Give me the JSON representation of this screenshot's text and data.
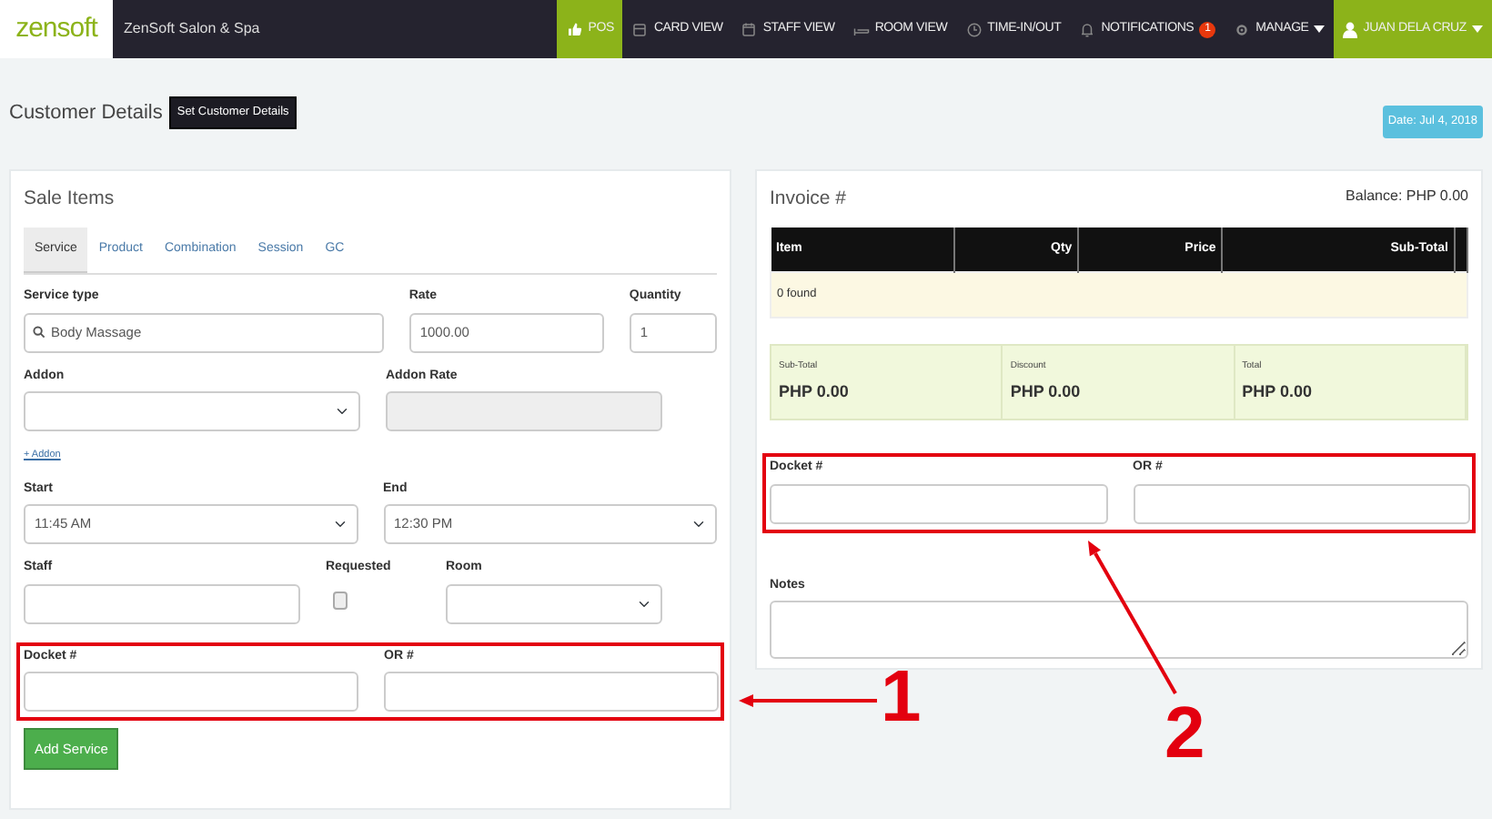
{
  "navbar": {
    "logo": "**zen**soft",
    "brand": "ZenSoft Salon & Spa",
    "items": [
      {
        "label": "POS",
        "selected": true
      },
      {
        "label": "CARD VIEW",
        "selected": false
      },
      {
        "label": "STAFF VIEW",
        "selected": false
      },
      {
        "label": "ROOM VIEW",
        "selected": false
      },
      {
        "label": "TIME-IN/OUT",
        "selected": false
      },
      {
        "label": "NOTIFICATIONS",
        "selected": false,
        "badge": "1"
      },
      {
        "label": "MANAGE",
        "selected": false,
        "dropdown": true
      }
    ],
    "user": {
      "label": "JUAN DELA CRUZ",
      "dropdown": true
    }
  },
  "header": {
    "title": "Customer Details",
    "button": "Set Customer Details",
    "date": "Date: Jul 4, 2018"
  },
  "sale_items": {
    "title": "Sale Items",
    "tabs": [
      {
        "label": "Service",
        "selected": true
      },
      {
        "label": "Product",
        "selected": false
      },
      {
        "label": "Combination",
        "selected": false
      },
      {
        "label": "Session",
        "selected": false
      },
      {
        "label": "GC",
        "selected": false
      }
    ],
    "service_type": {
      "label": "Service type",
      "value": "Body Massage"
    },
    "rate": {
      "label": "Rate",
      "value": "1000.00"
    },
    "quantity": {
      "label": "Quantity",
      "value": "1"
    },
    "addon": {
      "label": "Addon"
    },
    "addon_rate": {
      "label": "Addon Rate",
      "disabled": true
    },
    "add_addon": "+ Addon",
    "start": {
      "label": "Start",
      "value": "11:45 AM"
    },
    "end": {
      "label": "End",
      "value": "12:30 PM"
    },
    "staff": {
      "label": "Staff"
    },
    "requested": {
      "label": "Requested",
      "checked": false
    },
    "room": {
      "label": "Room"
    },
    "references_highlighted": true,
    "docket": {
      "label": "Docket #"
    },
    "or": {
      "label": "OR #"
    },
    "add_button": "Add Service"
  },
  "invoice": {
    "title": "Invoice #",
    "balance": "Balance: PHP 0.00",
    "table": {
      "columns": [
        "Item",
        "Qty",
        "Price",
        "Sub-Total"
      ],
      "empty_text": "0 found"
    },
    "totals": [
      {
        "label": "Sub-Total",
        "value": "PHP 0.00"
      },
      {
        "label": "Discount",
        "value": "PHP 0.00"
      },
      {
        "label": "Total",
        "value": "PHP 0.00"
      }
    ],
    "references_highlighted": true,
    "docket": {
      "label": "Docket #"
    },
    "or": {
      "label": "OR #"
    },
    "notes": {
      "label": "Notes"
    }
  },
  "annotations": [
    {
      "label": "1"
    },
    {
      "label": "2"
    }
  ]
}
